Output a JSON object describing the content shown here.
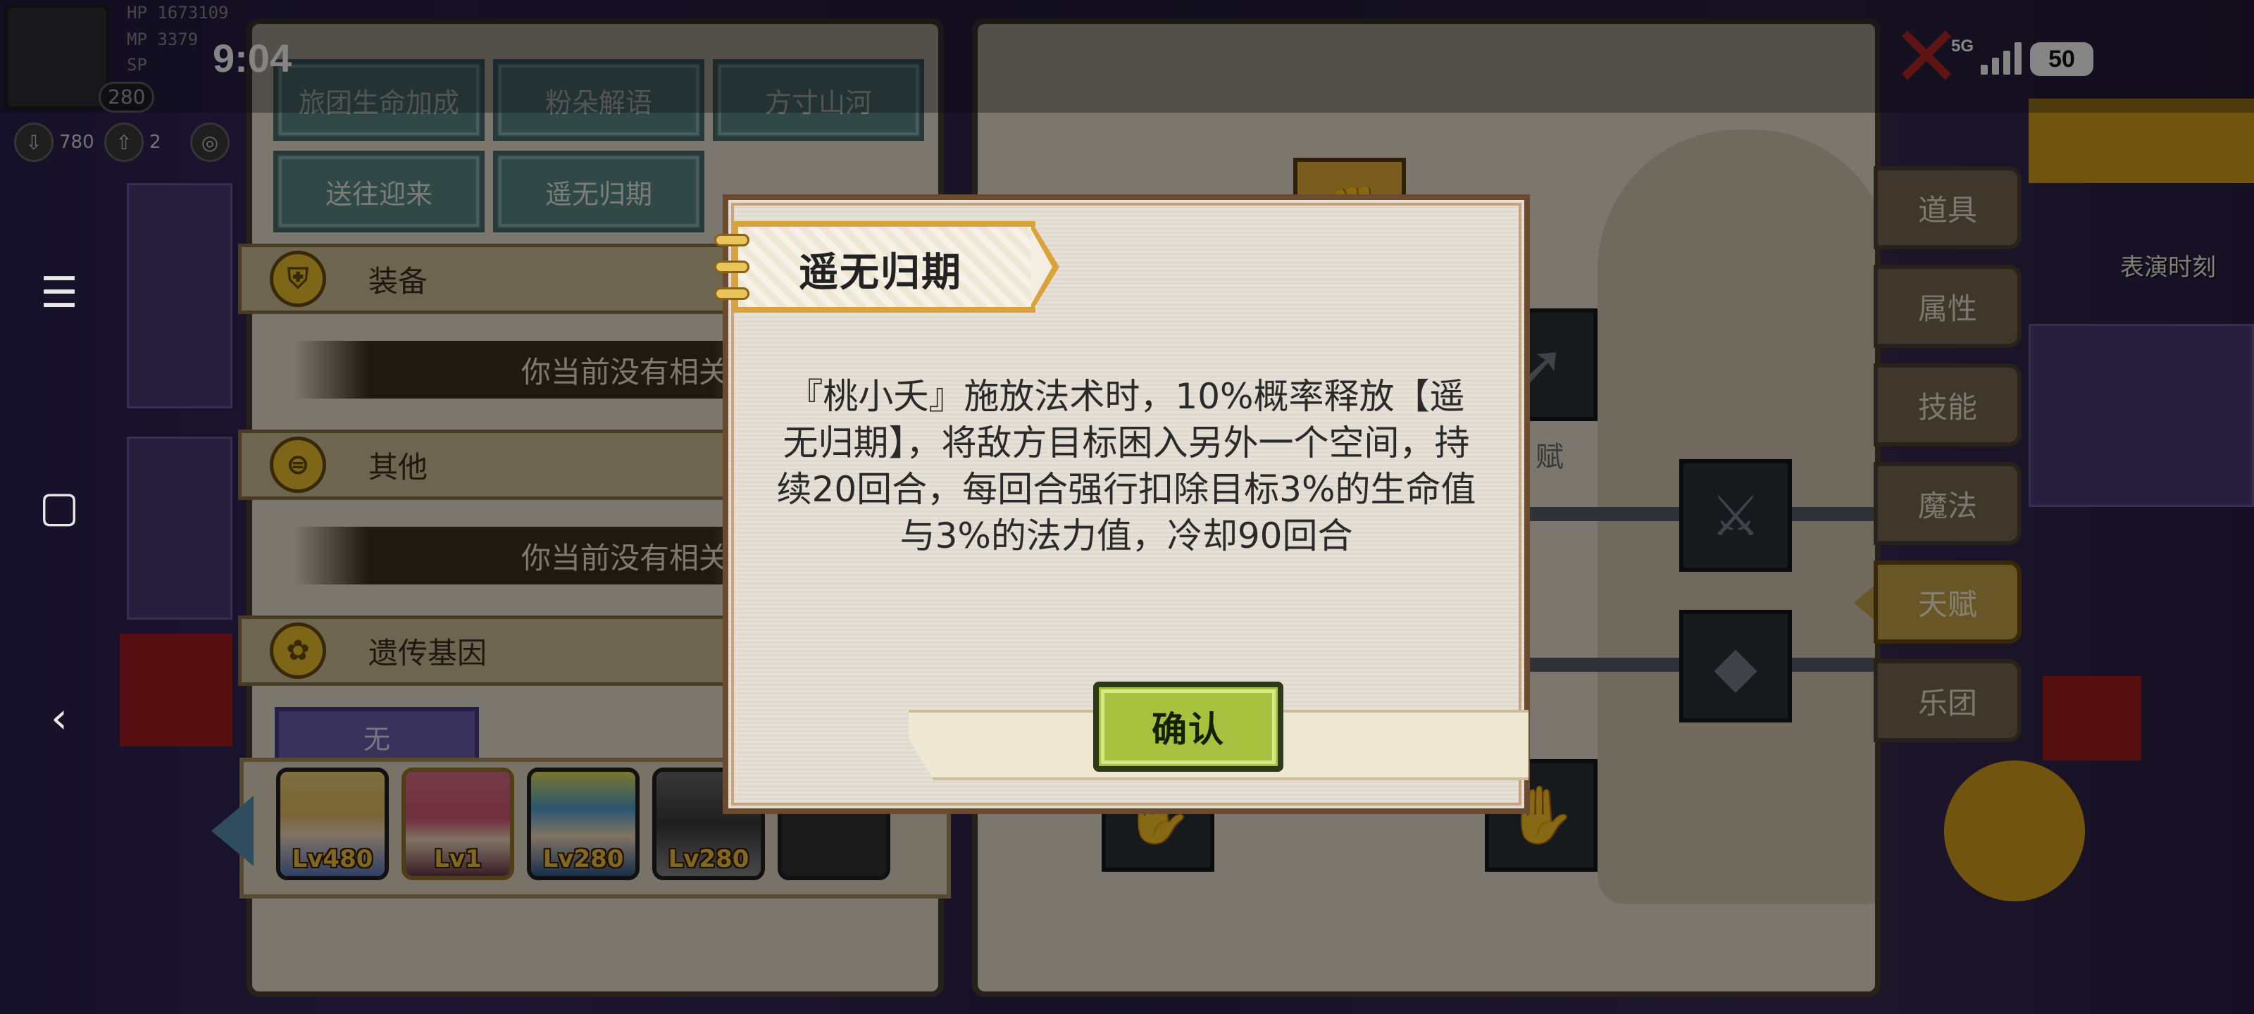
{
  "status_bar": {
    "time": "9:04",
    "network": "5G",
    "battery": "50"
  },
  "hud": {
    "hp": "HP 1673109",
    "mp": "MP 3379",
    "sp": "SP",
    "level": "280",
    "res1": "780",
    "res2": "2"
  },
  "android_nav": {
    "menu_icon": "menu-icon",
    "home_icon": "square-icon",
    "back_icon": "back-icon"
  },
  "traits": {
    "buttons": [
      "旅团生命加成",
      "粉朵解语",
      "方寸山河",
      "送往迎来",
      "遥无归期"
    ],
    "sections": [
      {
        "title": "装备",
        "icon": "armor-icon"
      },
      {
        "title": "其他",
        "icon": "coin-icon"
      },
      {
        "title": "遗传基因",
        "icon": "gene-icon"
      }
    ],
    "empty_note": "你当前没有相关特性",
    "none_label": "无"
  },
  "party": {
    "heroes": [
      {
        "name": "hero-blonde",
        "level": "Lv480"
      },
      {
        "name": "hero-pink",
        "level": "Lv1"
      },
      {
        "name": "hero-blue",
        "level": "Lv280"
      },
      {
        "name": "hero-mech",
        "level": "Lv280"
      }
    ]
  },
  "talent_tree": {
    "label": "赋"
  },
  "side_tabs": [
    "道具",
    "属性",
    "技能",
    "魔法",
    "天赋",
    "乐团"
  ],
  "active_tab": "天赋",
  "perform_label": "表演时刻",
  "dialog": {
    "title": "遥无归期",
    "text": "『桃小夭』施放法术时，10%概率释放【遥无归期】，将敌方目标困入另外一个空间，持续20回合，每回合强行扣除目标3%的生命值与3%的法力值，冷却90回合",
    "confirm_label": "确认"
  },
  "colors": {
    "accent": "#a8c23f",
    "banner": "#d9a23a",
    "trait_button": "#5d8a87",
    "active_tab": "#c9a64a",
    "close": "#b62828"
  }
}
